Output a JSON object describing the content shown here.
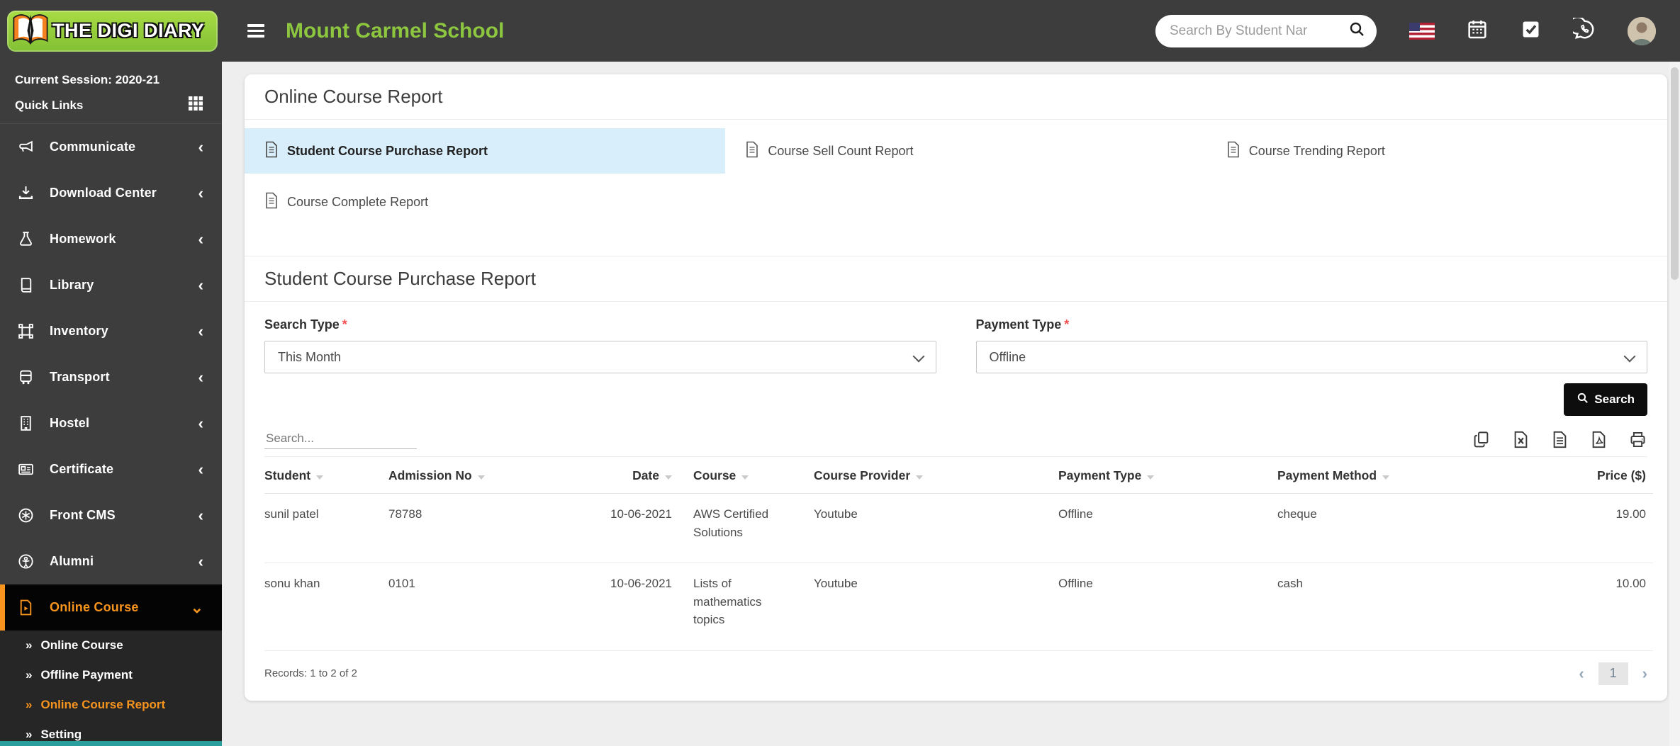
{
  "colors": {
    "header_bg": "#3d3d3d",
    "brand_green": "#8dc63f",
    "accent_orange": "#f7941e",
    "active_tab_bg": "#d9eefb",
    "button_bg": "#0d0d0d",
    "submenu_bg": "#262626",
    "page_bg": "#eeeeee"
  },
  "header": {
    "logo_text": "THE DIGI DIARY",
    "school_name": "Mount Carmel School",
    "search_placeholder": "Search By Student Nar",
    "icons": [
      "us-flag",
      "calendar",
      "tasks",
      "whatsapp",
      "user-avatar"
    ]
  },
  "sidebar": {
    "session_label": "Current Session: 2020-21",
    "quick_links_label": "Quick Links",
    "items": [
      {
        "label": "Communicate",
        "icon": "megaphone"
      },
      {
        "label": "Download Center",
        "icon": "download"
      },
      {
        "label": "Homework",
        "icon": "flask"
      },
      {
        "label": "Library",
        "icon": "book"
      },
      {
        "label": "Inventory",
        "icon": "box-select"
      },
      {
        "label": "Transport",
        "icon": "bus"
      },
      {
        "label": "Hostel",
        "icon": "building"
      },
      {
        "label": "Certificate",
        "icon": "id-card"
      },
      {
        "label": "Front CMS",
        "icon": "asterisk-circle"
      },
      {
        "label": "Alumni",
        "icon": "person-circle"
      }
    ],
    "active_item": {
      "label": "Online Course",
      "icon": "video-file"
    },
    "submenu": [
      {
        "label": "Online Course",
        "active": false
      },
      {
        "label": "Offline Payment",
        "active": false
      },
      {
        "label": "Online Course Report",
        "active": true
      },
      {
        "label": "Setting",
        "active": false
      }
    ]
  },
  "main": {
    "page_title": "Online Course Report",
    "tabs": [
      {
        "label": "Student Course Purchase Report",
        "active": true
      },
      {
        "label": "Course Sell Count Report",
        "active": false
      },
      {
        "label": "Course Trending Report",
        "active": false
      },
      {
        "label": "Course Complete Report",
        "active": false
      }
    ],
    "section_title": "Student Course Purchase Report",
    "form": {
      "search_type_label": "Search Type",
      "search_type_value": "This Month",
      "payment_type_label": "Payment Type",
      "payment_type_value": "Offline",
      "required_marker": "*",
      "search_button_label": "Search"
    },
    "table": {
      "filter_placeholder": "Search...",
      "export_icons": [
        "copy",
        "excel",
        "csv",
        "pdf",
        "print"
      ],
      "columns": [
        "Student",
        "Admission No",
        "Date",
        "Course",
        "Course Provider",
        "Payment Type",
        "Payment Method",
        "Price ($)"
      ],
      "rows": [
        [
          "sunil patel",
          "78788",
          "10-06-2021",
          "AWS Certified Solutions",
          "Youtube",
          "Offline",
          "cheque",
          "19.00"
        ],
        [
          "sonu khan",
          "0101",
          "10-06-2021",
          "Lists of mathematics topics",
          "Youtube",
          "Offline",
          "cash",
          "10.00"
        ]
      ],
      "records_text": "Records: 1 to 2 of 2",
      "pagination": {
        "page": "1"
      }
    }
  }
}
